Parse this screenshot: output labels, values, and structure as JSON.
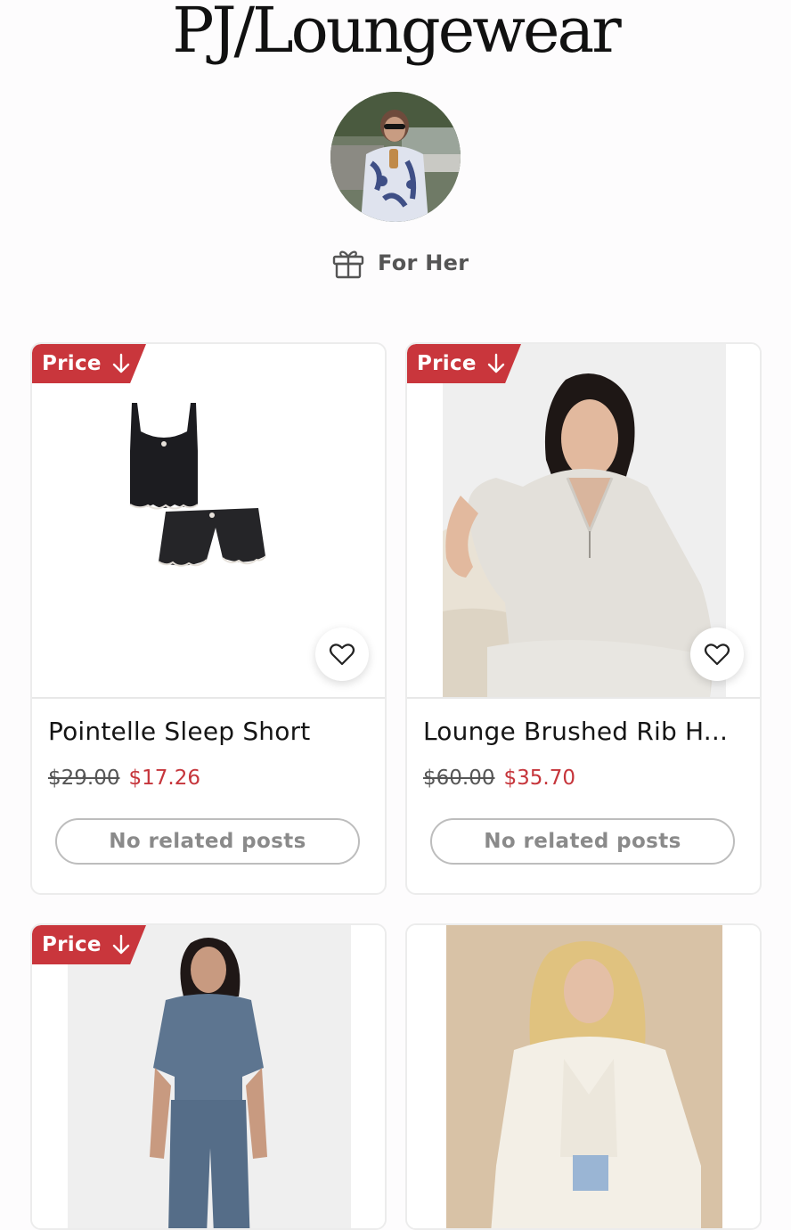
{
  "page": {
    "title": "PJ/Loungewear"
  },
  "collection": {
    "label": "For Her",
    "icon": "gift-icon"
  },
  "colors": {
    "accent_red": "#c9363c",
    "sale_price": "#c6353b"
  },
  "products": [
    {
      "badge": "Price",
      "name": "Pointelle Sleep Short",
      "old_price": "$29.00",
      "new_price": "$17.26",
      "posts": "No related posts"
    },
    {
      "badge": "Price",
      "name": "Lounge Brushed Rib H...",
      "old_price": "$60.00",
      "new_price": "$35.70",
      "posts": "No related posts"
    },
    {
      "badge": "Price"
    },
    {}
  ]
}
